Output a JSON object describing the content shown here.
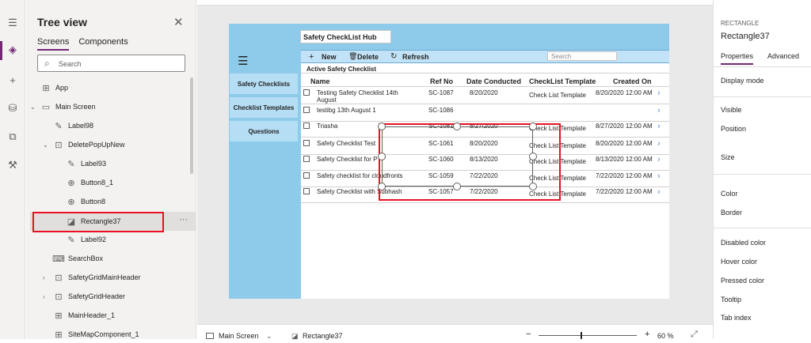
{
  "rail": {
    "icons": [
      "hamburger-icon",
      "layers-icon",
      "plus-icon",
      "database-icon",
      "media-icon",
      "tools-icon"
    ]
  },
  "tree": {
    "title": "Tree view",
    "close": "✕",
    "tab_screens": "Screens",
    "tab_components": "Components",
    "search_placeholder": "Search",
    "items": [
      {
        "label": "App"
      },
      {
        "label": "Main Screen"
      },
      {
        "label": "Label98"
      },
      {
        "label": "DeletePopUpNew"
      },
      {
        "label": "Label93"
      },
      {
        "label": "Button8_1"
      },
      {
        "label": "Button8"
      },
      {
        "label": "Rectangle37"
      },
      {
        "label": "Label92"
      },
      {
        "label": "SearchBox"
      },
      {
        "label": "SafetyGridMainHeader"
      },
      {
        "label": "SafetyGridHeader"
      },
      {
        "label": "MainHeader_1"
      },
      {
        "label": "SiteMapComponent_1"
      }
    ],
    "more": "···"
  },
  "app": {
    "title": "Safety CheckList Hub",
    "nav": [
      "Safety Checklists",
      "Checklist Templates",
      "Questions"
    ],
    "toolbar": {
      "new": "New",
      "delete": "Delete",
      "refresh": "Refresh",
      "search": "Search"
    },
    "grid_title": "Active Safety Checklist",
    "columns": [
      "Name",
      "Ref No",
      "Date Conducted",
      "CheckList Template",
      "Created On"
    ],
    "rows": [
      {
        "name": "Testing Safety Checklist 14th August",
        "ref": "SC-1087",
        "date": "8/20/2020",
        "template": "Check List Template",
        "created": "8/20/2020 12:00 AM"
      },
      {
        "name": "testibg 13th August 1",
        "ref": "SC-1086",
        "date": "",
        "template": "",
        "created": ""
      },
      {
        "name": "Triasha",
        "ref": "SC-1081",
        "date": "8/27/2020",
        "template": "Check List Template",
        "created": "8/27/2020 12:00 AM"
      },
      {
        "name": "Safety Checklist Test",
        "ref": "SC-1061",
        "date": "8/20/2020",
        "template": "Check List Template",
        "created": "8/20/2020 12:00 AM"
      },
      {
        "name": "Safety Checklist for P",
        "ref": "SC-1060",
        "date": "8/13/2020",
        "template": "Check List Template",
        "created": "8/13/2020 12:00 AM"
      },
      {
        "name": "Safety checklist for cloudfronts",
        "ref": "SC-1059",
        "date": "7/22/2020",
        "template": "Check List Template",
        "created": "7/22/2020 12:00 AM"
      },
      {
        "name": "Safety Checklist with Subhash",
        "ref": "SC-1057",
        "date": "7/22/2020",
        "template": "Check List Template",
        "created": "7/22/2020 12:00 AM"
      }
    ]
  },
  "props": {
    "kind": "RECTANGLE",
    "name": "Rectangle37",
    "tab_properties": "Properties",
    "tab_advanced": "Advanced",
    "items": [
      "Display mode",
      "Visible",
      "Position",
      "Size",
      "Color",
      "Border",
      "Disabled color",
      "Hover color",
      "Pressed color",
      "Tooltip",
      "Tab index"
    ]
  },
  "bottom": {
    "screen": "Main Screen",
    "selected": "Rectangle37",
    "minus": "−",
    "plus": "+",
    "zoom": "60 %"
  }
}
